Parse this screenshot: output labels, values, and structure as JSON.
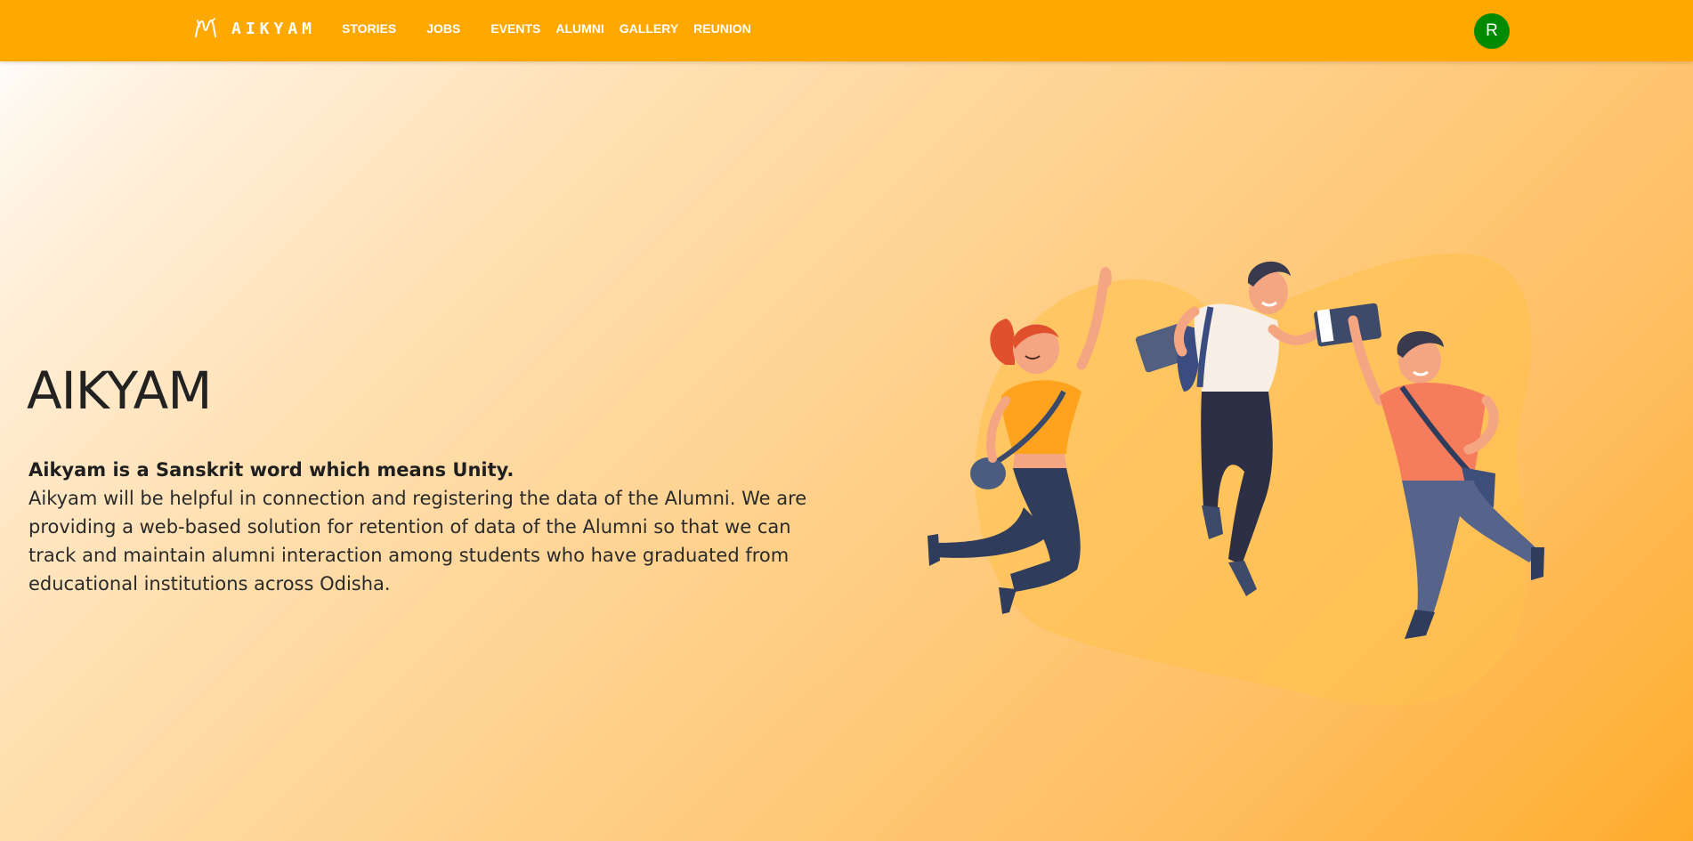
{
  "header": {
    "brand": "AIKYAM",
    "logo_icon": "aikyam-logo-icon",
    "nav": [
      {
        "label": "STORIES"
      },
      {
        "label": "JOBS"
      },
      {
        "label": "EVENTS"
      },
      {
        "label": "ALUMNI"
      },
      {
        "label": "GALLERY"
      },
      {
        "label": "REUNION"
      }
    ],
    "avatar_initial": "R",
    "bar_color": "#ffa800",
    "avatar_color": "#008a00"
  },
  "hero": {
    "title": "AIKYAM",
    "tagline": "Aikyam is a Sanskrit word which means Unity.",
    "description": "Aikyam will be helpful in connection and registering the data of the Alumni. We are providing a web-based solution for retention of data of the Alumni so that we can track and maintain alumni interaction among students who have graduated from educational institutions across Odisha.",
    "illustration": "three-students-jumping-illustration"
  }
}
